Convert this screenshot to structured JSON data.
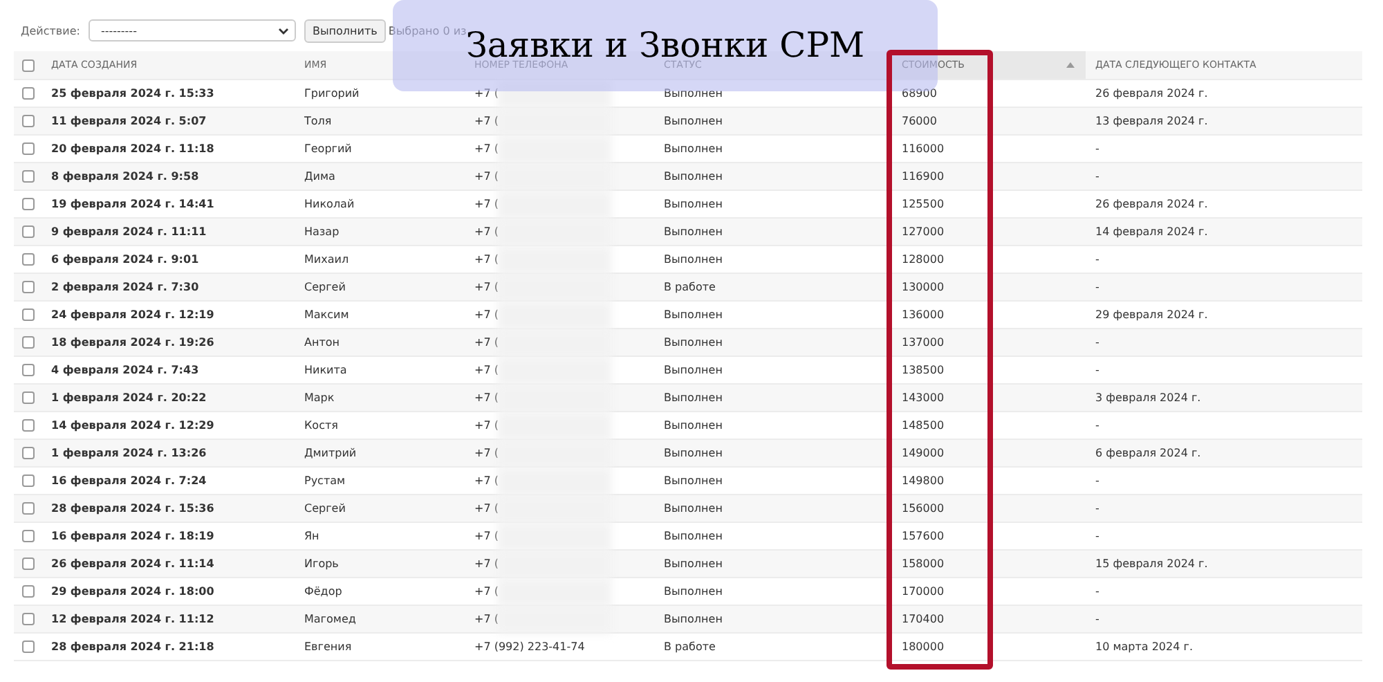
{
  "toolbar": {
    "action_label": "Действие:",
    "action_value": "---------",
    "run_button": "Выполнить",
    "selection_count": "Выбрано 0 из"
  },
  "banner": {
    "title": "Заявки и Звонки CPM"
  },
  "table": {
    "all_selected": false,
    "columns": [
      {
        "label": "ДАТА СОЗДАНИЯ",
        "sorted": false
      },
      {
        "label": "ИМЯ",
        "sorted": false
      },
      {
        "label": "НОМЕР ТЕЛЕФОНА",
        "sorted": false
      },
      {
        "label": "СТАТУС",
        "sorted": false
      },
      {
        "label": "СТОИМОСТЬ",
        "sorted": true
      },
      {
        "label": "ДАТА СЛЕДУЮЩЕГО КОНТАКТА",
        "sorted": false
      }
    ],
    "rows": [
      {
        "selected": false,
        "created": "25 февраля 2024 г. 15:33",
        "name": "Григорий",
        "phone": "+7 (",
        "masked": true,
        "status": "Выполнен",
        "cost": "68900",
        "next_contact": "26 февраля 2024 г."
      },
      {
        "selected": false,
        "created": "11 февраля 2024 г. 5:07",
        "name": "Толя",
        "phone": "+7 (",
        "masked": true,
        "status": "Выполнен",
        "cost": "76000",
        "next_contact": "13 февраля 2024 г."
      },
      {
        "selected": false,
        "created": "20 февраля 2024 г. 11:18",
        "name": "Георгий",
        "phone": "+7 (",
        "masked": true,
        "status": "Выполнен",
        "cost": "116000",
        "next_contact": "-"
      },
      {
        "selected": false,
        "created": "8 февраля 2024 г. 9:58",
        "name": "Дима",
        "phone": "+7 (",
        "masked": true,
        "status": "Выполнен",
        "cost": "116900",
        "next_contact": "-"
      },
      {
        "selected": false,
        "created": "19 февраля 2024 г. 14:41",
        "name": "Николай",
        "phone": "+7 (",
        "masked": true,
        "status": "Выполнен",
        "cost": "125500",
        "next_contact": "26 февраля 2024 г."
      },
      {
        "selected": false,
        "created": "9 февраля 2024 г. 11:11",
        "name": "Назар",
        "phone": "+7 (",
        "masked": true,
        "status": "Выполнен",
        "cost": "127000",
        "next_contact": "14 февраля 2024 г."
      },
      {
        "selected": false,
        "created": "6 февраля 2024 г. 9:01",
        "name": "Михаил",
        "phone": "+7 (",
        "masked": true,
        "status": "Выполнен",
        "cost": "128000",
        "next_contact": "-"
      },
      {
        "selected": false,
        "created": "2 февраля 2024 г. 7:30",
        "name": "Сергей",
        "phone": "+7 (",
        "masked": true,
        "status": "В работе",
        "cost": "130000",
        "next_contact": "-"
      },
      {
        "selected": false,
        "created": "24 февраля 2024 г. 12:19",
        "name": "Максим",
        "phone": "+7 (",
        "masked": true,
        "status": "Выполнен",
        "cost": "136000",
        "next_contact": "29 февраля 2024 г."
      },
      {
        "selected": false,
        "created": "18 февраля 2024 г. 19:26",
        "name": "Антон",
        "phone": "+7 (",
        "masked": true,
        "status": "Выполнен",
        "cost": "137000",
        "next_contact": "-"
      },
      {
        "selected": false,
        "created": "4 февраля 2024 г. 7:43",
        "name": "Никита",
        "phone": "+7 (",
        "masked": true,
        "status": "Выполнен",
        "cost": "138500",
        "next_contact": "-"
      },
      {
        "selected": false,
        "created": "1 февраля 2024 г. 20:22",
        "name": "Марк",
        "phone": "+7 (",
        "masked": true,
        "status": "Выполнен",
        "cost": "143000",
        "next_contact": "3 февраля 2024 г."
      },
      {
        "selected": false,
        "created": "14 февраля 2024 г. 12:29",
        "name": "Костя",
        "phone": "+7 (",
        "masked": true,
        "status": "Выполнен",
        "cost": "148500",
        "next_contact": "-"
      },
      {
        "selected": false,
        "created": "1 февраля 2024 г. 13:26",
        "name": "Дмитрий",
        "phone": "+7 (",
        "masked": true,
        "status": "Выполнен",
        "cost": "149000",
        "next_contact": "6 февраля 2024 г."
      },
      {
        "selected": false,
        "created": "16 февраля 2024 г. 7:24",
        "name": "Рустам",
        "phone": "+7 (",
        "masked": true,
        "status": "Выполнен",
        "cost": "149800",
        "next_contact": "-"
      },
      {
        "selected": false,
        "created": "28 февраля 2024 г. 15:36",
        "name": "Сергей",
        "phone": "+7 (",
        "masked": true,
        "status": "Выполнен",
        "cost": "156000",
        "next_contact": "-"
      },
      {
        "selected": false,
        "created": "16 февраля 2024 г. 18:19",
        "name": "Ян",
        "phone": "+7 (",
        "masked": true,
        "status": "Выполнен",
        "cost": "157600",
        "next_contact": "-"
      },
      {
        "selected": false,
        "created": "26 февраля 2024 г. 11:14",
        "name": "Игорь",
        "phone": "+7 (",
        "masked": true,
        "status": "Выполнен",
        "cost": "158000",
        "next_contact": "15 февраля 2024 г."
      },
      {
        "selected": false,
        "created": "29 февраля 2024 г. 18:00",
        "name": "Фёдор",
        "phone": "+7 (",
        "masked": true,
        "status": "Выполнен",
        "cost": "170000",
        "next_contact": "-"
      },
      {
        "selected": false,
        "created": "12 февраля 2024 г. 11:12",
        "name": "Магомед",
        "phone": "+7 (",
        "masked": true,
        "status": "Выполнен",
        "cost": "170400",
        "next_contact": "-"
      },
      {
        "selected": false,
        "created": "28 февраля 2024 г. 21:18",
        "name": "Евгения",
        "phone": "+7 (992) 223-41-74",
        "masked": false,
        "status": "В работе",
        "cost": "180000",
        "next_contact": "10 марта 2024 г."
      }
    ]
  }
}
